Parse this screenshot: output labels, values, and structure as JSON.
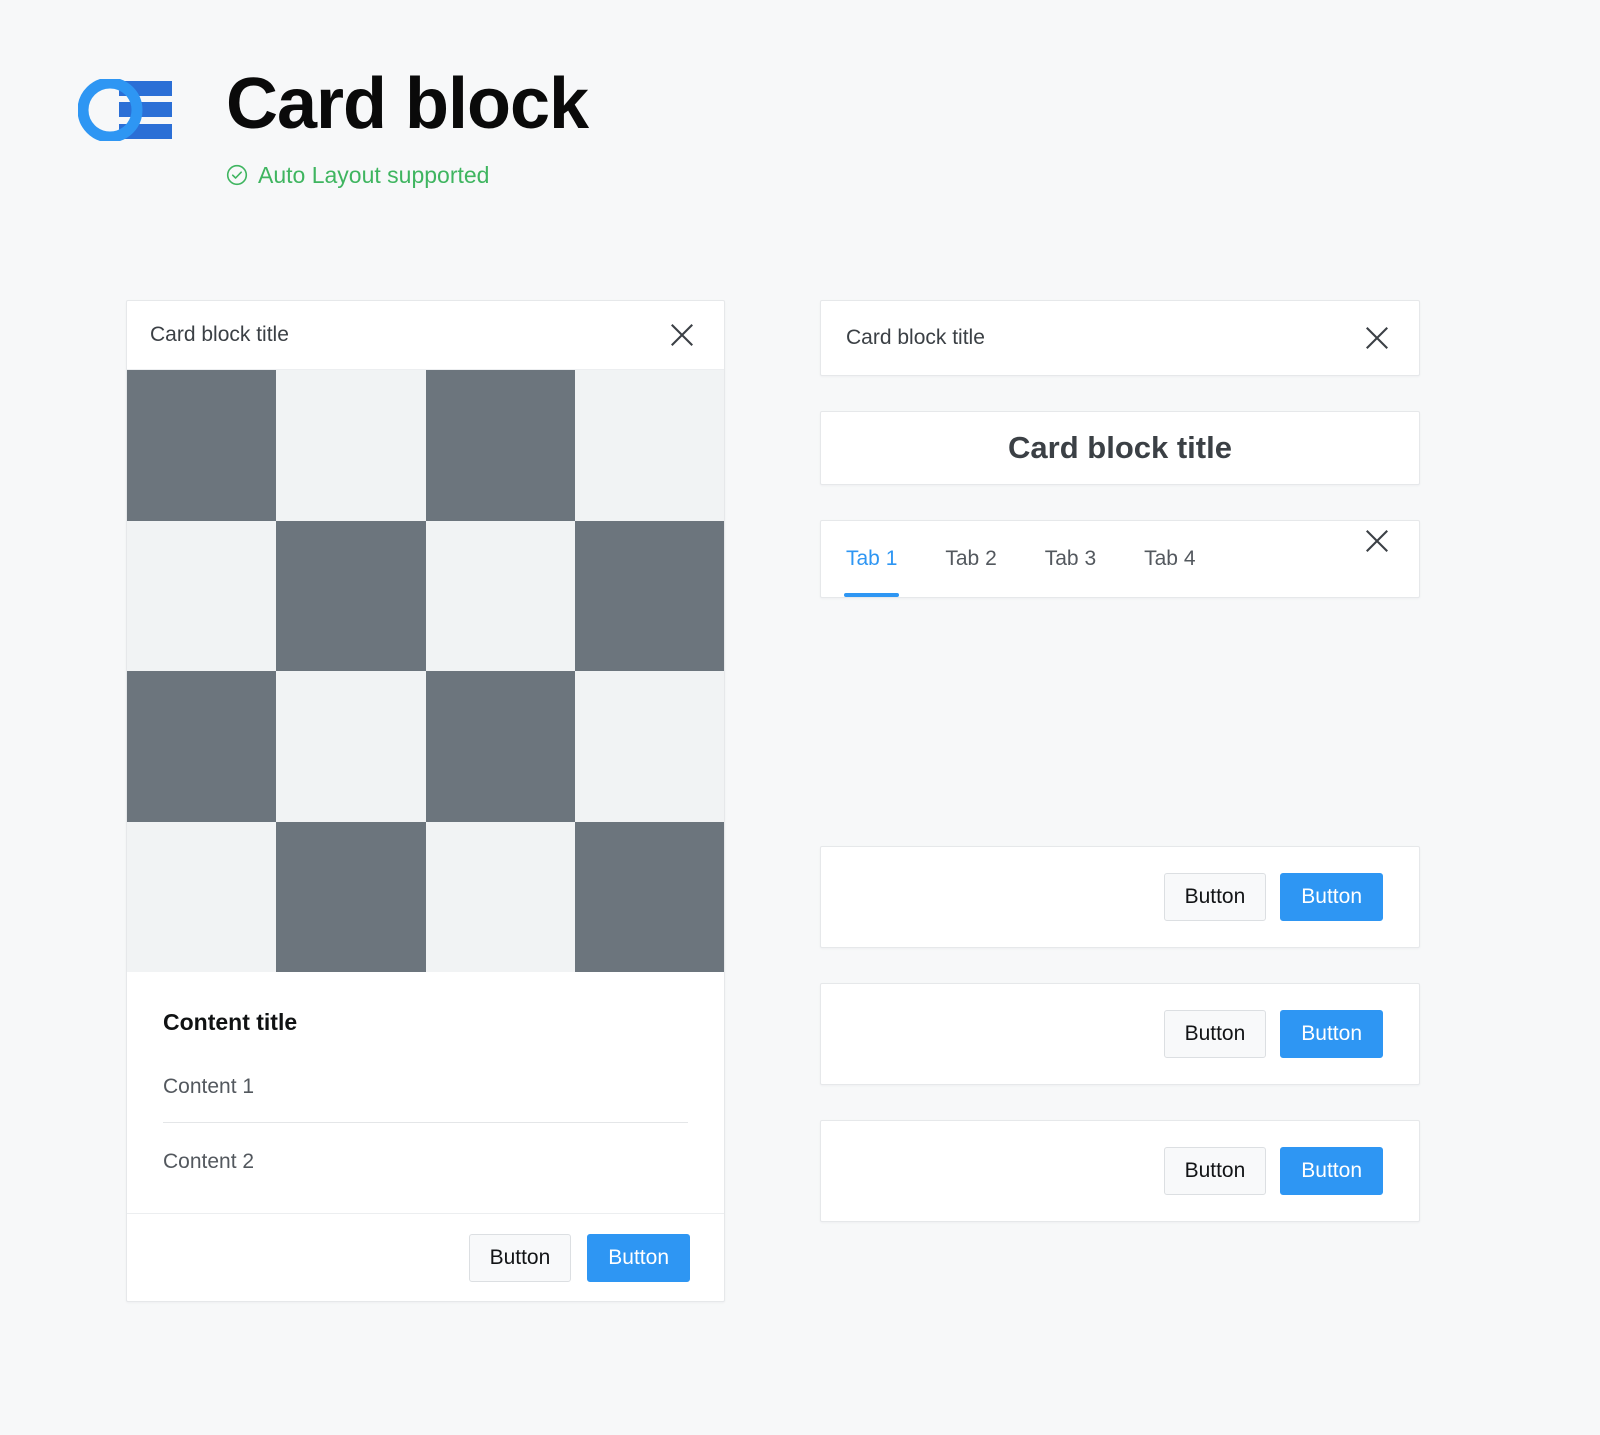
{
  "header": {
    "logo_icon": "oe-monogram-logo",
    "title": "Card block",
    "badge": {
      "icon": "check-circle-icon",
      "label": "Auto Layout supported",
      "color": "#3fb560"
    }
  },
  "colors": {
    "background": "#f7f8f9",
    "card_background": "#ffffff",
    "border": "#e6e8ea",
    "primary": "#2e96f3",
    "secondary_bg": "#f8f9fa",
    "placeholder_dark": "#6c757d",
    "placeholder_light": "#f1f3f4",
    "text_primary": "#101213",
    "text_secondary": "#53585e",
    "accent_green": "#3fb560"
  },
  "left_card": {
    "header": {
      "title": "Card block title",
      "close_icon": "close-icon"
    },
    "placeholder": {
      "icon": "image-placeholder-checkerboard",
      "rows": 4,
      "columns": 4,
      "pattern": [
        [
          1,
          0,
          1,
          0
        ],
        [
          0,
          1,
          0,
          1
        ],
        [
          1,
          0,
          1,
          0
        ],
        [
          0,
          1,
          0,
          1
        ]
      ]
    },
    "body": {
      "content_title": "Content title",
      "rows": [
        "Content 1",
        "Content 2"
      ]
    },
    "footer": {
      "secondary_label": "Button",
      "primary_label": "Button"
    }
  },
  "right_column": {
    "header_card": {
      "title": "Card block title",
      "close_icon": "close-icon"
    },
    "title_card": {
      "title": "Card block title"
    },
    "tabs_card": {
      "tabs": [
        {
          "label": "Tab 1",
          "active": true
        },
        {
          "label": "Tab 2",
          "active": false
        },
        {
          "label": "Tab 3",
          "active": false
        },
        {
          "label": "Tab 4",
          "active": false
        }
      ],
      "close_icon": "close-icon"
    },
    "button_bars": [
      {
        "secondary_label": "Button",
        "primary_label": "Button"
      },
      {
        "secondary_label": "Button",
        "primary_label": "Button"
      },
      {
        "secondary_label": "Button",
        "primary_label": "Button"
      }
    ]
  }
}
